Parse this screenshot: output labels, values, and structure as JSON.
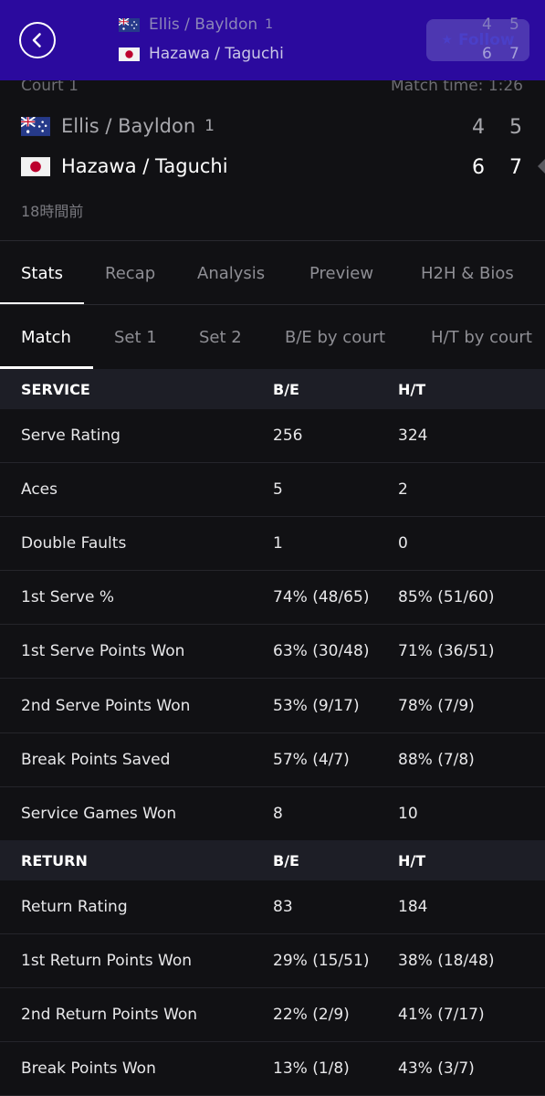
{
  "topbar": {
    "team1": "Ellis / Bayldon",
    "team1_seed": "1",
    "team2": "Hazawa / Taguchi",
    "team1_scores": [
      "4",
      "5"
    ],
    "team2_scores": [
      "6",
      "7"
    ],
    "follow_label": "Follow"
  },
  "match": {
    "court": "Court 1",
    "match_time": "Match time: 1:26",
    "team1": "Ellis / Bayldon",
    "team1_seed": "1",
    "team2": "Hazawa / Taguchi",
    "team1_scores": [
      "4",
      "5"
    ],
    "team2_scores": [
      "6",
      "7"
    ],
    "time_ago": "18時間前"
  },
  "main_tabs": [
    "Stats",
    "Recap",
    "Analysis",
    "Preview",
    "H2H & Bios"
  ],
  "sub_tabs": [
    "Match",
    "Set 1",
    "Set 2",
    "B/E by court",
    "H/T by court"
  ],
  "service": {
    "header": "SERVICE",
    "col1": "B/E",
    "col2": "H/T",
    "rows": [
      {
        "label": "Serve Rating",
        "a": "256",
        "b": "324"
      },
      {
        "label": "Aces",
        "a": "5",
        "b": "2"
      },
      {
        "label": "Double Faults",
        "a": "1",
        "b": "0"
      },
      {
        "label": "1st Serve %",
        "a": "74% (48/65)",
        "b": "85% (51/60)"
      },
      {
        "label": "1st Serve Points Won",
        "a": "63% (30/48)",
        "b": "71% (36/51)"
      },
      {
        "label": "2nd Serve Points Won",
        "a": "53% (9/17)",
        "b": "78% (7/9)"
      },
      {
        "label": "Break Points Saved",
        "a": "57% (4/7)",
        "b": "88% (7/8)"
      },
      {
        "label": "Service Games Won",
        "a": "8",
        "b": "10"
      }
    ]
  },
  "return": {
    "header": "RETURN",
    "col1": "B/E",
    "col2": "H/T",
    "rows": [
      {
        "label": "Return Rating",
        "a": "83",
        "b": "184"
      },
      {
        "label": "1st Return Points Won",
        "a": "29% (15/51)",
        "b": "38% (18/48)"
      },
      {
        "label": "2nd Return Points Won",
        "a": "22% (2/9)",
        "b": "41% (7/17)"
      },
      {
        "label": "Break Points Won",
        "a": "13% (1/8)",
        "b": "43% (3/7)"
      }
    ]
  },
  "colors": {
    "topbar_bg": "#2b0a9e",
    "page_bg": "#111114",
    "section_bg": "#1d1e26"
  }
}
